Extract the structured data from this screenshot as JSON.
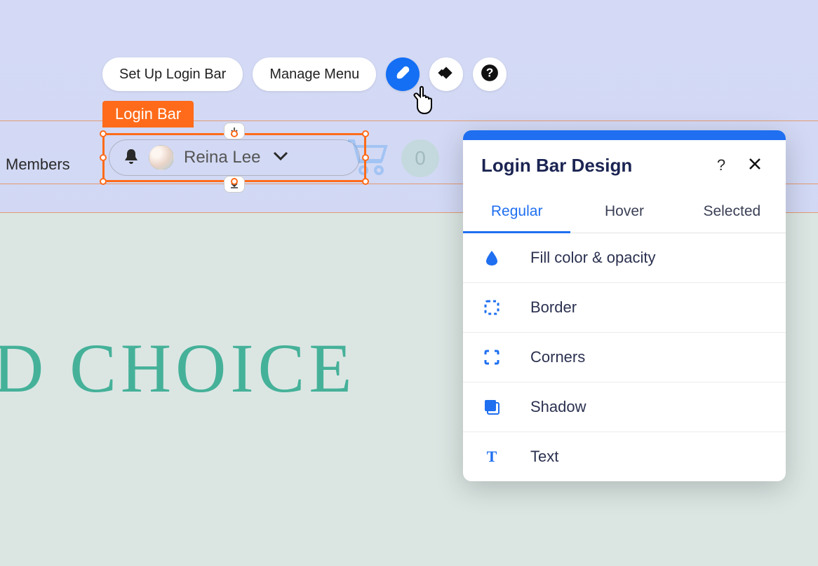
{
  "toolbar": {
    "setup_label": "Set Up Login Bar",
    "manage_label": "Manage Menu"
  },
  "selection": {
    "tag_label": "Login Bar"
  },
  "section": {
    "label": "Members"
  },
  "login_bar": {
    "username": "Reina Lee"
  },
  "cart": {
    "count": "0"
  },
  "background_heading": "D CHOICE",
  "panel": {
    "title": "Login Bar Design",
    "tabs": {
      "regular": "Regular",
      "hover": "Hover",
      "selected": "Selected"
    },
    "options": {
      "fill": "Fill color & opacity",
      "border": "Border",
      "corners": "Corners",
      "shadow": "Shadow",
      "text": "Text"
    }
  }
}
